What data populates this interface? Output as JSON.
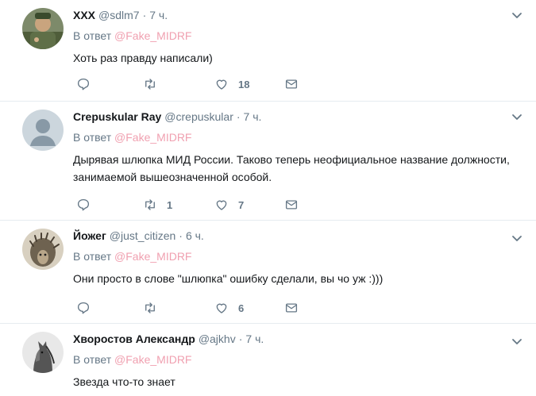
{
  "tweets": [
    {
      "name": "XXX",
      "handle": "@sdlm7",
      "separator": "·",
      "time": "7 ч.",
      "reply_prefix": "В ответ",
      "reply_to": "@Fake_MIDRF",
      "text": "Хоть раз правду написали)",
      "retweets": "",
      "likes": "18"
    },
    {
      "name": "Crepuskular Ray",
      "handle": "@crepuskular",
      "separator": "·",
      "time": "7 ч.",
      "reply_prefix": "В ответ",
      "reply_to": "@Fake_MIDRF",
      "text": "Дырявая шлюпка МИД России. Таково теперь неофициальное название должности, занимаемой вышеозначенной особой.",
      "retweets": "1",
      "likes": "7"
    },
    {
      "name": "Йожег",
      "handle": "@just_citizen",
      "separator": "·",
      "time": "6 ч.",
      "reply_prefix": "В ответ",
      "reply_to": "@Fake_MIDRF",
      "text": "Они просто в слове \"шлюпка\" ошибку сделали, вы чо уж :)))",
      "retweets": "",
      "likes": "6"
    },
    {
      "name": "Хворостов Александр",
      "handle": "@ajkhv",
      "separator": "·",
      "time": "7 ч.",
      "reply_prefix": "В ответ",
      "reply_to": "@Fake_MIDRF",
      "text": "Звезда что-то знает",
      "retweets": "",
      "likes": ""
    }
  ],
  "icons": {
    "reply": "reply-icon",
    "retweet": "retweet-icon",
    "like": "heart-icon",
    "dm": "envelope-icon",
    "more": "chevron-down-icon"
  },
  "colors": {
    "link": "#f0a0b0",
    "muted": "#657786",
    "divider": "#e6ecf0"
  }
}
